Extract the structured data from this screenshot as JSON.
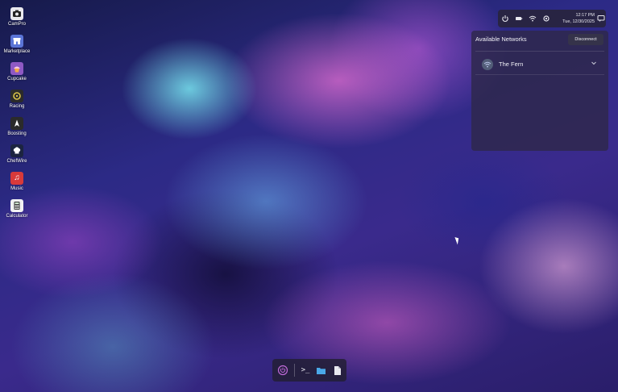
{
  "desktop": {
    "icons": [
      {
        "label": "CamPro",
        "icon": "camera-icon",
        "color": "#e9e9ee"
      },
      {
        "label": "Marketplace",
        "icon": "store-icon",
        "color": "#5a74d6"
      },
      {
        "label": "Cupcake",
        "icon": "cupcake-icon",
        "color": "#8e59c4"
      },
      {
        "label": "Racing",
        "icon": "racing-icon",
        "color": "#2b2b2b"
      },
      {
        "label": "Boosting",
        "icon": "boost-icon",
        "color": "#2b2b2b"
      },
      {
        "label": "ChefWire",
        "icon": "chef-hat-icon",
        "color": "#1c2440"
      },
      {
        "label": "Music",
        "icon": "music-icon",
        "color": "#d83a3a"
      },
      {
        "label": "Calculator",
        "icon": "calculator-icon",
        "color": "#f1f1f3"
      }
    ]
  },
  "status_bar": {
    "time": "12:17 PM",
    "date": "Tue, 12/30/2025",
    "icons": [
      "power-icon",
      "battery-icon",
      "wifi-icon",
      "settings-icon",
      "notifications-icon"
    ]
  },
  "network_panel": {
    "title": "Available Networks",
    "disconnect_label": "Disconnect",
    "networks": [
      {
        "ssid": "The Fern",
        "connected": true
      }
    ]
  },
  "dock": {
    "items": [
      "power-icon",
      "terminal-icon",
      "folder-icon",
      "document-icon"
    ],
    "accent": "#c06ad8",
    "folder_color": "#4aa8e8"
  }
}
